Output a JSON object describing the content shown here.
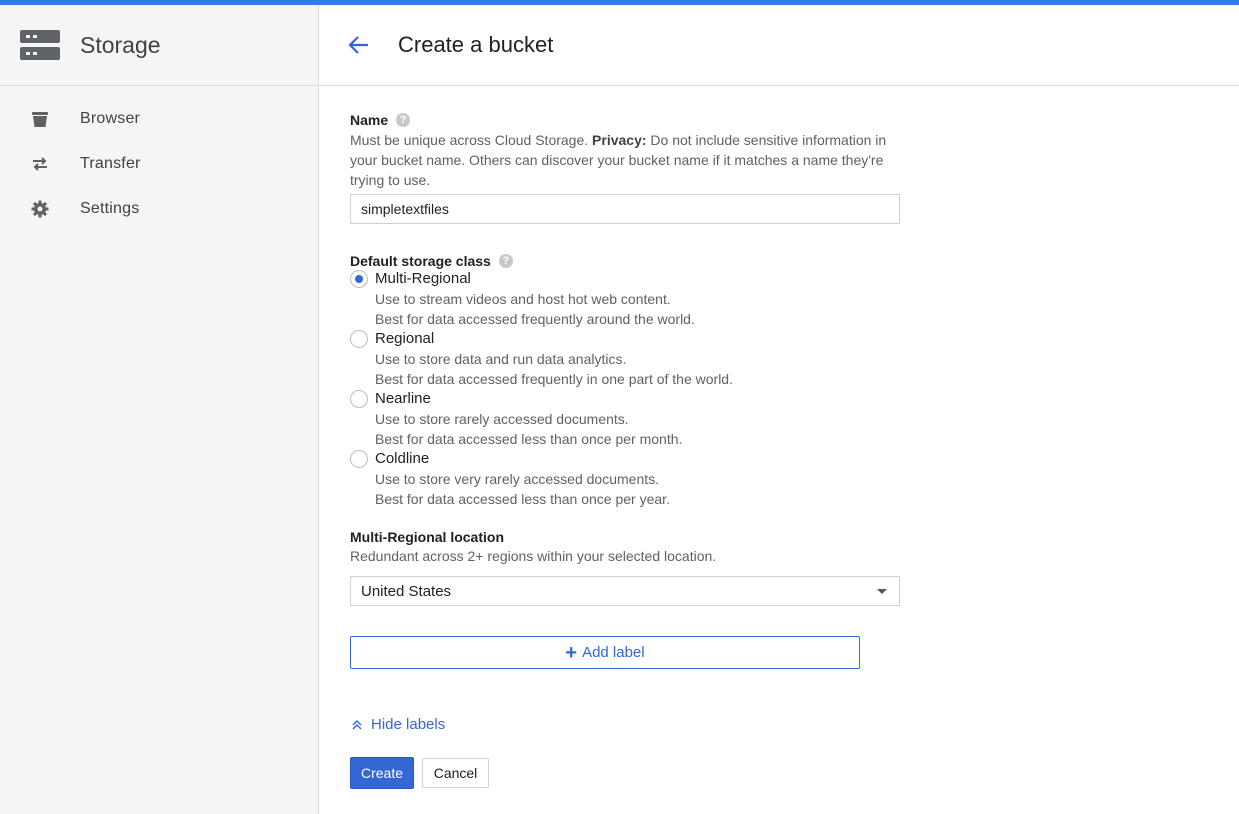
{
  "accent_color": "#3b78e7",
  "primary_color": "#3367d6",
  "sidebar": {
    "title": "Storage",
    "icon": "storage-icon",
    "items": [
      {
        "label": "Browser",
        "icon": "bucket-icon"
      },
      {
        "label": "Transfer",
        "icon": "transfer-icon"
      },
      {
        "label": "Settings",
        "icon": "gear-icon"
      }
    ]
  },
  "header": {
    "back_icon": "back-arrow-icon",
    "title": "Create a bucket"
  },
  "form": {
    "name": {
      "label": "Name",
      "help": "?",
      "desc_before": "Must be unique across Cloud Storage. ",
      "desc_bold": "Privacy:",
      "desc_after": " Do not include sensitive information in your bucket name. Others can discover your bucket name if it matches a name they're trying to use.",
      "value": "simpletextfiles"
    },
    "storage_class": {
      "label": "Default storage class",
      "help": "?",
      "selected": "Multi-Regional",
      "options": [
        {
          "label": "Multi-Regional",
          "line1": "Use to stream videos and host hot web content.",
          "line2": "Best for data accessed frequently around the world."
        },
        {
          "label": "Regional",
          "line1": "Use to store data and run data analytics.",
          "line2": "Best for data accessed frequently in one part of the world."
        },
        {
          "label": "Nearline",
          "line1": "Use to store rarely accessed documents.",
          "line2": "Best for data accessed less than once per month."
        },
        {
          "label": "Coldline",
          "line1": "Use to store very rarely accessed documents.",
          "line2": "Best for data accessed less than once per year."
        }
      ]
    },
    "location": {
      "label": "Multi-Regional location",
      "desc": "Redundant across 2+ regions within your selected location.",
      "value": "United States"
    },
    "add_label": {
      "plus": "+",
      "text": "Add label"
    },
    "hide_labels": "Hide labels",
    "create_button": "Create",
    "cancel_button": "Cancel"
  }
}
